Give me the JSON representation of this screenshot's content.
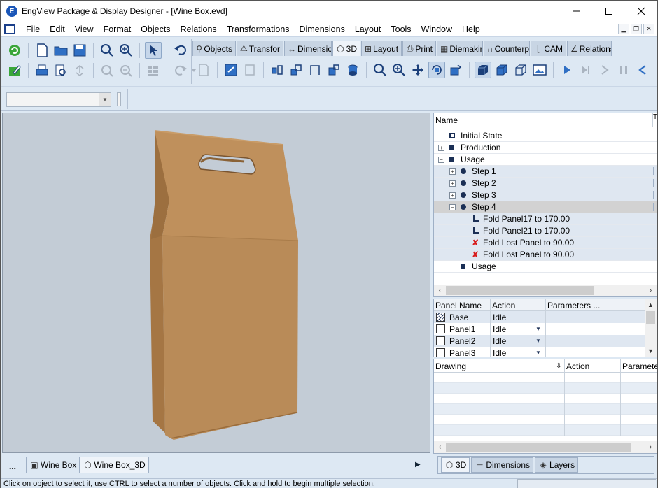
{
  "window": {
    "title": "EngView Package & Display Designer - [Wine Box.evd]",
    "app_icon_glyph": "E",
    "controls": [
      "minimize-icon",
      "maximize-icon",
      "close-icon"
    ]
  },
  "menu": {
    "items": [
      "File",
      "Edit",
      "View",
      "Format",
      "Objects",
      "Relations",
      "Transformations",
      "Dimensions",
      "Layout",
      "Tools",
      "Window",
      "Help"
    ]
  },
  "mode_tabs": [
    {
      "label": "Objects",
      "icon": "objects-icon",
      "selected": false
    },
    {
      "label": "Transfor",
      "icon": "transform-icon",
      "selected": false
    },
    {
      "label": "Dimensic",
      "icon": "dimension-icon",
      "selected": false
    },
    {
      "label": "3D",
      "icon": "cube-icon",
      "selected": true
    },
    {
      "label": "Layout",
      "icon": "layout-icon",
      "selected": false
    },
    {
      "label": "Print",
      "icon": "print-icon",
      "selected": false
    },
    {
      "label": "Diemakir",
      "icon": "diemaking-icon",
      "selected": false
    },
    {
      "label": "Counterp",
      "icon": "counter-icon",
      "selected": false
    },
    {
      "label": "CAM",
      "icon": "cam-icon",
      "selected": false
    },
    {
      "label": "Relations",
      "icon": "relations-icon",
      "selected": false
    }
  ],
  "combo": {
    "value": ""
  },
  "tree": {
    "header": "Name",
    "header_t": "T",
    "rows": [
      {
        "label": "Initial State",
        "node": "hollow",
        "expander": "",
        "indent": 0
      },
      {
        "label": "Production",
        "node": "square",
        "expander": "+",
        "indent": 0
      },
      {
        "label": "Usage",
        "node": "square",
        "expander": "−",
        "indent": 0
      },
      {
        "label": "Step 1",
        "node": "dot",
        "expander": "+",
        "indent": 1
      },
      {
        "label": "Step 2",
        "node": "dot",
        "expander": "+",
        "indent": 1
      },
      {
        "label": "Step 3",
        "node": "dot",
        "expander": "+",
        "indent": 1
      },
      {
        "label": "Step 4",
        "node": "dot",
        "expander": "−",
        "indent": 1,
        "selected": true
      },
      {
        "label": "Fold Panel17 to 170.00",
        "node": "fold",
        "expander": "",
        "indent": 2
      },
      {
        "label": "Fold Panel21 to 170.00",
        "node": "fold",
        "expander": "",
        "indent": 2
      },
      {
        "label": "Fold Lost Panel to 90.00",
        "node": "fold-x",
        "expander": "",
        "indent": 2
      },
      {
        "label": "Fold Lost Panel to 90.00",
        "node": "fold-x",
        "expander": "",
        "indent": 2
      },
      {
        "label": "Usage",
        "node": "square",
        "expander": "",
        "indent": 1
      }
    ]
  },
  "panel_table": {
    "headers": [
      "Panel Name",
      "Action",
      "Parameters ..."
    ],
    "rows": [
      {
        "name": "Base",
        "action": "Idle",
        "hatched": true,
        "dropdown": false
      },
      {
        "name": "Panel1",
        "action": "Idle",
        "hatched": false,
        "dropdown": true
      },
      {
        "name": "Panel2",
        "action": "Idle",
        "hatched": false,
        "dropdown": true
      },
      {
        "name": "Panel3",
        "action": "Idle",
        "hatched": false,
        "dropdown": true
      }
    ]
  },
  "drawing_table": {
    "headers": [
      "Drawing",
      "Action",
      "Paramete"
    ]
  },
  "right_bottom_tabs": [
    {
      "label": "3D",
      "icon": "cube-icon",
      "selected": true
    },
    {
      "label": "Dimensions",
      "icon": "dimension-icon",
      "selected": false
    },
    {
      "label": "Layers",
      "icon": "layers-icon",
      "selected": false
    }
  ],
  "doc_tabs": {
    "more": "...",
    "tabs": [
      {
        "label": "Wine Box",
        "icon": "document-icon",
        "current": false
      },
      {
        "label": "Wine Box_3D",
        "icon": "cube-icon",
        "current": true
      }
    ]
  },
  "statusbar": {
    "message": "Click on object to select it, use CTRL to select a number of objects. Click and hold to begin multiple selection."
  },
  "colors": {
    "box_front": "#b98b58",
    "box_side": "#a57644",
    "viewport_bg": "#c3ccd6",
    "selected_row": "#d2d2d2",
    "accent": "#1b2f55"
  }
}
